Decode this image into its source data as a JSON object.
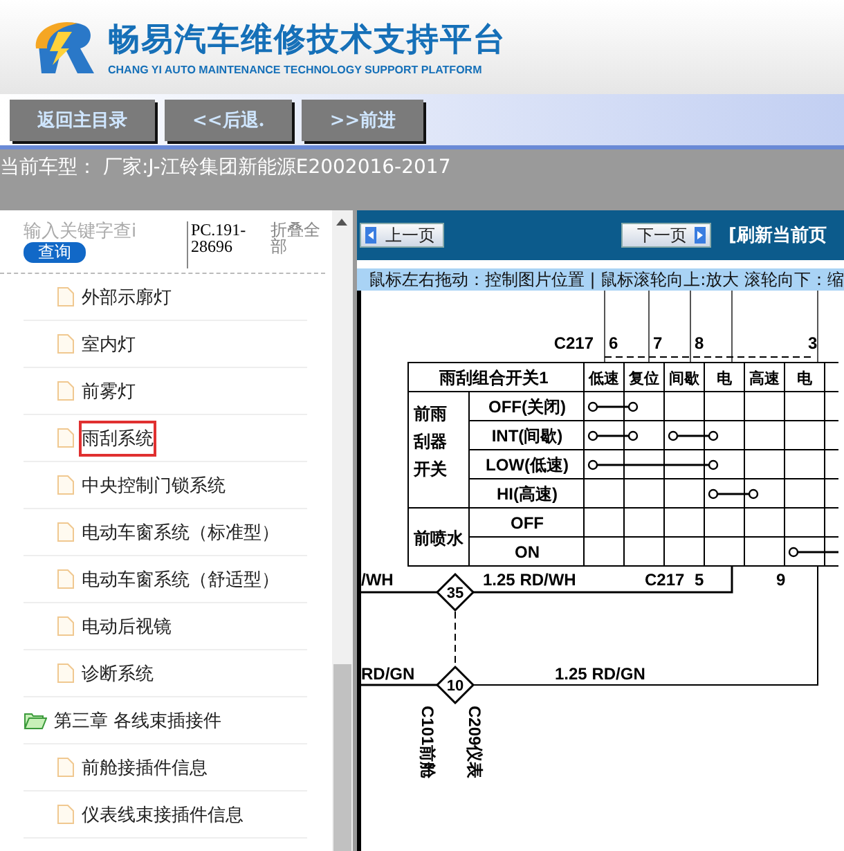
{
  "header": {
    "title": "畅易汽车维修技术支持平台",
    "subtitle": "CHANG YI AUTO MAINTENANCE TECHNOLOGY SUPPORT PLATFORM"
  },
  "nav_buttons": [
    "返回主目录",
    "<<后退.",
    ">>前进"
  ],
  "current_model": "当前车型： 厂家:J-江铃集团新能源E2002016-2017",
  "sidebar": {
    "search": {
      "placeholder": "输入关键字查i"
    },
    "search_button": "查询",
    "code": "PC.191-28696",
    "collapse_all": "折叠全部",
    "tree": [
      {
        "children": [
          {
            "label": "外部示廓灯",
            "kind": "file",
            "selected": false
          },
          {
            "label": "室内灯",
            "kind": "file",
            "selected": false
          },
          {
            "label": "前雾灯",
            "kind": "file",
            "selected": false
          },
          {
            "label": "雨刮系统",
            "kind": "file",
            "selected": true
          },
          {
            "label": "中央控制门锁系统",
            "kind": "file",
            "selected": false
          },
          {
            "label": "电动车窗系统（标准型）",
            "kind": "file",
            "selected": false
          },
          {
            "label": "电动车窗系统（舒适型）",
            "kind": "file",
            "selected": false
          },
          {
            "label": "电动后视镜",
            "kind": "file",
            "selected": false
          },
          {
            "label": "诊断系统",
            "kind": "file",
            "selected": false
          }
        ]
      },
      {
        "label": "第三章 各线束插接件",
        "kind": "folder",
        "expanded": true,
        "children": [
          {
            "label": "前舱接插件信息",
            "kind": "file",
            "selected": false
          },
          {
            "label": "仪表线束接插件信息",
            "kind": "file",
            "selected": false
          }
        ]
      }
    ]
  },
  "viewer": {
    "prev_button": "上一页",
    "next_button": "下一页",
    "refresh": "[刷新当前页",
    "hint": "鼠标左右拖动：控制图片位置 | 鼠标滚轮向上:放大  滚轮向下：缩",
    "diagram": {
      "table_title": "雨刮组合开关1",
      "columns": [
        "低速",
        "复位",
        "间歇",
        "电",
        "高速",
        "电"
      ],
      "groups": [
        {
          "label": "前雨刮器开关",
          "rows": [
            {
              "label": "OFF(关闭)",
              "contacts": [
                true,
                true,
                false,
                false,
                false,
                false
              ]
            },
            {
              "label": "INT(间歇)",
              "contacts": [
                true,
                true,
                true,
                true,
                false,
                false
              ]
            },
            {
              "label": "LOW(低速)",
              "contacts": [
                true,
                false,
                false,
                true,
                false,
                false
              ]
            },
            {
              "label": "HI(高速)",
              "contacts": [
                false,
                false,
                false,
                true,
                true,
                false
              ]
            }
          ]
        },
        {
          "label": "前喷水",
          "rows": [
            {
              "label": "OFF",
              "contacts": [
                false,
                false,
                false,
                false,
                false,
                false
              ]
            },
            {
              "label": "ON",
              "contacts": [
                false,
                false,
                false,
                false,
                false,
                true
              ]
            }
          ]
        }
      ],
      "top_connector": "C217",
      "top_pins": [
        "6",
        "7",
        "8",
        "3"
      ],
      "bottom_connector": "C217",
      "bottom_pins": [
        "5",
        "9"
      ],
      "wires": [
        "/WH",
        "1.25 RD/WH",
        "RD/GN",
        "1.25 RD/GN"
      ],
      "splices": [
        "35",
        "10"
      ],
      "vertical_labels": [
        "C101前舱",
        "C209仪表"
      ]
    }
  }
}
